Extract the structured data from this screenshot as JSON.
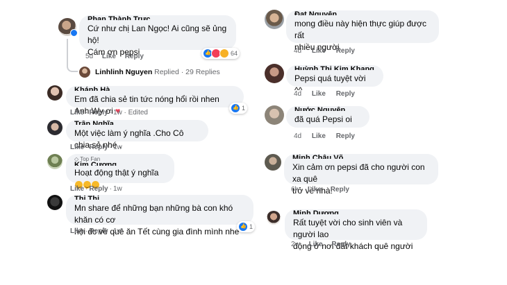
{
  "thread_top": {
    "author_cut": "Phan Thành Trực",
    "text": "Cứ như chị Lan Ngọc! Ai cũng sẽ ủng hộ!\nCám ơn pepsi",
    "time": "5d",
    "like": "Like",
    "reply": "Reply",
    "reaction_count": "64",
    "replied_summary": {
      "name": "Linhlinh Nguyen",
      "action": "Replied",
      "count": "· 29 Replies"
    }
  },
  "left_comments": [
    {
      "author_cut": "Khánh Hà",
      "text": "Em đã chia sẻ tin tức nóng hổi rồi nhen Anh Wy ơi",
      "trailing_emoji": "heart",
      "time": "1w",
      "edited": "· Edited",
      "reactions": "1"
    },
    {
      "author_cut": "Trần Nghĩa",
      "text": "Một việc làm ý nghĩa .Cho Cô chia sẻ nhé .",
      "time": "1w"
    },
    {
      "top_fan": "Top Fan",
      "author_cut": "Kim Cương",
      "text": "Hoạt động thật ý nghĩa",
      "trailing_emoji": "laugh3",
      "time": "1w"
    },
    {
      "author_cut": "Thi Thi",
      "text": "Mn share để những bạn những bà con khó khăn có cơ\nhội dc về quê ăn Tết cùng gia đình mình nhe",
      "time": "1w",
      "reactions": "1"
    }
  ],
  "right_comments": [
    {
      "author_cut": "Đạt Nguyễn",
      "text": "mong điều này hiện thực giúp được rất\nnhiều người",
      "time": "4d"
    },
    {
      "author_cut": "Huỳnh Thị Kim Khang",
      "text": "Pepsi quá tuyệt vời ^^",
      "time": "4d"
    },
    {
      "author_cut": "Nước Nguyễn Khang",
      "text": "đã quá Pepsi oi",
      "time": "4d"
    },
    {
      "author_cut": "Minh Châu Võ",
      "text": "Xin cảm ơn pepsi đã cho người con xa quê\ntrở về nhà!",
      "time": "6h"
    },
    {
      "author_cut": "Minh Dương",
      "text": "Rất tuyệt vời cho sinh viên và người lao\nđộng ở nơi đất khách quê người",
      "time": "2w"
    }
  ],
  "labels": {
    "like": "Like",
    "reply": "Reply",
    "dot": "·"
  },
  "colors": {
    "bubble": "#f0f2f5",
    "meta": "#65676b",
    "accent": "#1877f2"
  }
}
